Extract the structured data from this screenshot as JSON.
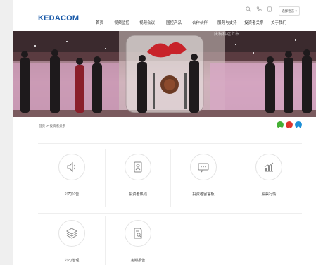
{
  "header": {
    "logo": "KEDACOM",
    "lang": "选择语言 ▾",
    "nav": [
      "首页",
      "视频监控",
      "视频会议",
      "图控产品",
      "合作伙伴",
      "服务与支持",
      "投资者关系",
      "关于我们"
    ]
  },
  "banner": {
    "title": "庆祝科达上市"
  },
  "breadcrumb": "首页 > 投资者关系",
  "cards": [
    {
      "label": "公司公告",
      "icon": "speaker-icon"
    },
    {
      "label": "投资者热线",
      "icon": "contact-card-icon"
    },
    {
      "label": "投资者留言板",
      "icon": "message-board-icon"
    },
    {
      "label": "股票行情",
      "icon": "stock-chart-icon"
    },
    {
      "label": "公司治理",
      "icon": "layers-icon"
    },
    {
      "label": "定期报告",
      "icon": "report-search-icon"
    }
  ],
  "colors": {
    "brand": "#1a5aa8",
    "wechat": "#45b035",
    "weibo": "#e0332c",
    "qq": "#1e8fd6"
  }
}
